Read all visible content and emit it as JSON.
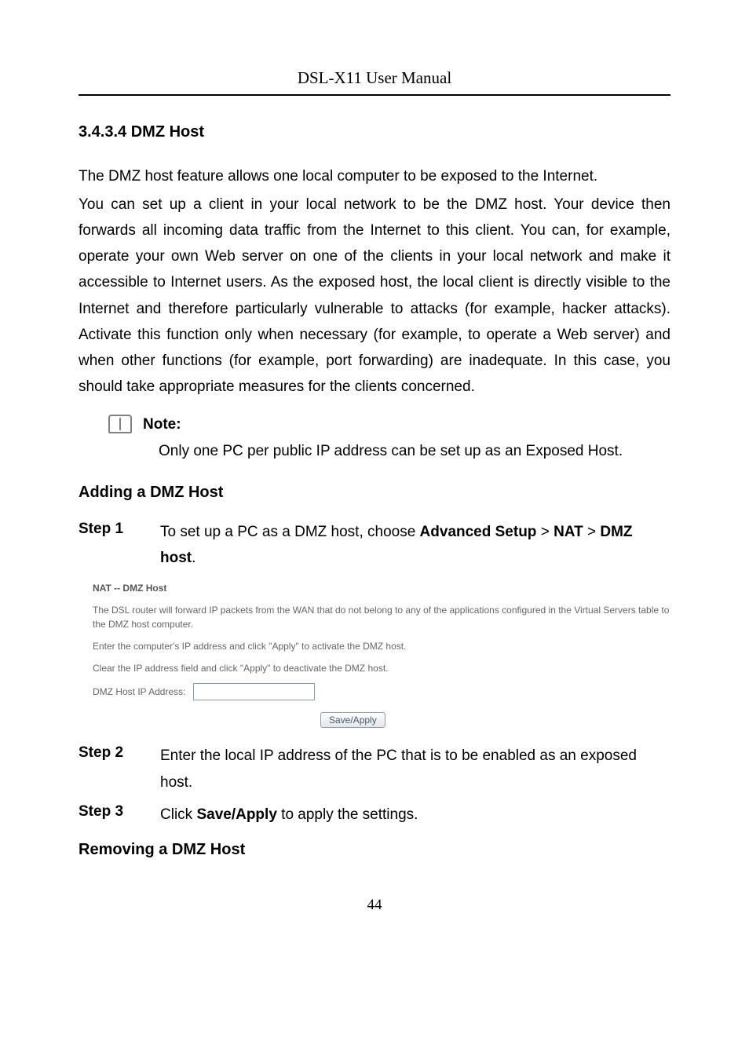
{
  "header": {
    "title": "DSL-X11 User Manual"
  },
  "section": {
    "number_title": "3.4.3.4  DMZ Host",
    "lead": "The DMZ host feature allows one local computer to be exposed to the Internet.",
    "para1": "You can set up a client in your local network to be the DMZ host. Your device then forwards all incoming data traffic from the Internet to this client. You can, for example, operate your own Web server on one of the clients in your local network and make it accessible to Internet users. As the exposed host, the local client is directly visible to the Internet and therefore particularly vulnerable to attacks (for example, hacker attacks). Activate this function only when necessary (for example, to operate a Web server) and when other functions (for example, port forwarding) are inadequate. In this case, you should take appropriate measures for the clients concerned."
  },
  "note": {
    "label": "Note:",
    "text": "Only one PC per public IP address can be set up as an Exposed Host."
  },
  "adding": {
    "heading": "Adding a DMZ Host",
    "steps": [
      {
        "label": "Step 1",
        "segments": [
          {
            "t": "To set up a PC as a DMZ host, choose ",
            "b": false
          },
          {
            "t": "Advanced Setup",
            "b": true
          },
          {
            "t": " > ",
            "b": false
          },
          {
            "t": "NAT",
            "b": true
          },
          {
            "t": " > ",
            "b": false
          },
          {
            "t": "DMZ host",
            "b": true
          },
          {
            "t": ".",
            "b": false
          }
        ]
      },
      {
        "label": "Step 2",
        "segments": [
          {
            "t": "Enter the local IP address of the PC that is to be enabled as an exposed host.",
            "b": false
          }
        ]
      },
      {
        "label": "Step 3",
        "segments": [
          {
            "t": "Click ",
            "b": false
          },
          {
            "t": "Save/Apply",
            "b": true
          },
          {
            "t": " to apply the settings.",
            "b": false
          }
        ]
      }
    ]
  },
  "screenshot": {
    "title": "NAT -- DMZ Host",
    "line1": "The DSL router will forward IP packets from the WAN that do not belong to any of the applications configured in the Virtual Servers table to the DMZ host computer.",
    "line2": "Enter the computer's IP address and click \"Apply\" to activate the DMZ host.",
    "line3": "Clear the IP address field and click \"Apply\" to deactivate the DMZ host.",
    "field_label": "DMZ Host IP Address:",
    "field_value": "",
    "button": "Save/Apply"
  },
  "removing": {
    "heading": "Removing a DMZ Host"
  },
  "page_number": "44"
}
